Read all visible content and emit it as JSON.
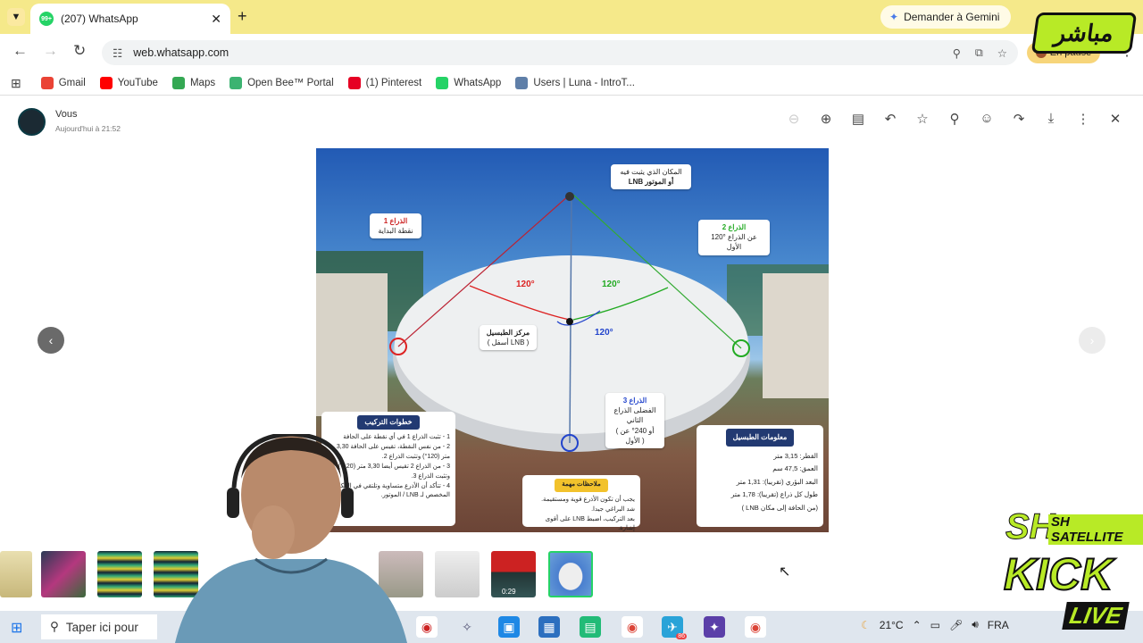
{
  "browser": {
    "tab_title": "(207) WhatsApp",
    "tab_badge": "99+",
    "gemini_label": "Demander à Gemini",
    "url": "web.whatsapp.com",
    "pause_label": "En pause",
    "bookmarks": [
      {
        "label": "Gmail",
        "color": "#ea4335"
      },
      {
        "label": "YouTube",
        "color": "#ff0000"
      },
      {
        "label": "Maps",
        "color": "#34a853"
      },
      {
        "label": "Open Bee™ Portal",
        "color": "#3cb371"
      },
      {
        "label": "(1) Pinterest",
        "color": "#e60023"
      },
      {
        "label": "WhatsApp",
        "color": "#25d366"
      },
      {
        "label": "Users | Luna - IntroT...",
        "color": "#5f7fa8"
      }
    ]
  },
  "viewer": {
    "sender": "Vous",
    "time": "Aujourd'hui à 21:52"
  },
  "image": {
    "lnb_label": [
      "المكان الذي يثبت فيه",
      "LNB أو الموتور"
    ],
    "arm1_label": [
      "الذراع 1",
      "نقطة البداية"
    ],
    "arm2_label": [
      "الذراع 2",
      "120° عن الذراع الأول"
    ],
    "arm3_label": [
      "الذراع 3",
      "الفضلى الذراع الثاني",
      "( أو 240° عن الأول )"
    ],
    "center_label": [
      "مركز الطبسيل",
      "( أسفل LNB )"
    ],
    "angles": [
      "120°",
      "120°",
      "120°"
    ],
    "steps_title": "خطوات التركيب",
    "steps": [
      "1 - تثبت الذراع 1 في أي نقطة على الحافة",
      "2 - من نفس النقطة، تقيس على الحافة 3,30 متر (120°) وتثبت الذراع 2.",
      "3 - من الذراع 2 تقيس أيضا 3,30 متر (120°) وتثبت الذراع 3.",
      "4 - تتأكد أن الأذرع متساوية وتلتقي في المكان المخصص لـ LNB / الموتور."
    ],
    "notes_title": "ملاحظات مهمة",
    "notes": [
      "يجب أن تكون الأذرع قوية ومستقيمة.",
      "شد البراغي جيدا.",
      "بعد التركيب، اضبط LNB على أقوى إشارة."
    ],
    "info_title": "معلومات الطبسيل",
    "info": [
      "القطر: 3,15 متر",
      "العمق: 47,5 سم",
      "البعد البؤري (تقريبا): 1,31 متر",
      "طول كل ذراع (تقريبا): 1,78 متر",
      "(من الحافة إلى مكان LNB )"
    ]
  },
  "thumbs": {
    "video_duration": "0:29"
  },
  "taskbar": {
    "search_placeholder": "Taper ici pour",
    "weather": "21°C",
    "lang": "FRA",
    "telegram_badge": "86"
  },
  "overlays": {
    "logo_top": "مباشر",
    "logo_sh": "SH",
    "logo_satellite": "SH SATELLITE",
    "logo_kick": "KICK",
    "logo_live": "LIVE"
  },
  "colors": {
    "tabbar_bg": "#f5e98a",
    "whatsapp_green": "#25d366",
    "kick_green": "#b8ea26"
  }
}
